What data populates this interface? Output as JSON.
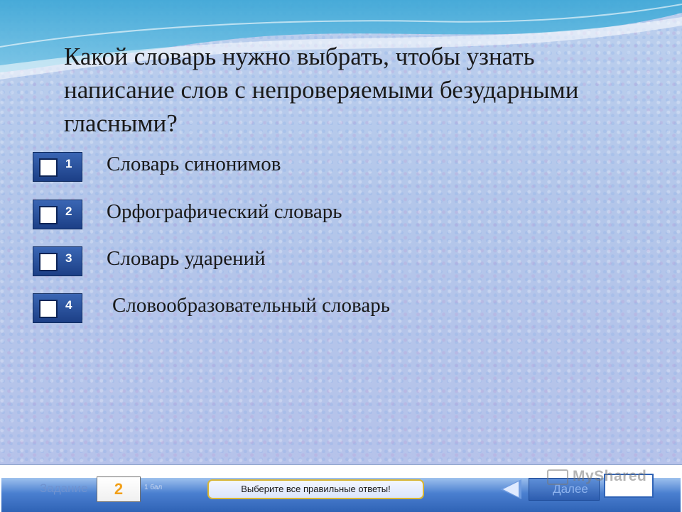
{
  "question": {
    "line1": "Какой словарь нужно выбрать, чтобы узнать",
    "line2": "написание слов с непроверяемыми безударными",
    "line3": "гласными?"
  },
  "options": [
    {
      "number": "1",
      "label": "Словарь синонимов"
    },
    {
      "number": "2",
      "label": "Орфографический словарь"
    },
    {
      "number": "3",
      "label": "Словарь ударений"
    },
    {
      "number": "4",
      "label": "Словообразовательный словарь"
    }
  ],
  "footer": {
    "task_label": "Задание",
    "task_number": "2",
    "points": "1 бал",
    "hint": "Выберите все правильные ответы!",
    "next_label": "Далее"
  },
  "watermark": "MyShared",
  "colors": {
    "checkbox_blue": "#2a52a0",
    "task_number_orange": "#f2a019",
    "hint_border": "#d9b634",
    "bottom_strip": "#2f63b6"
  }
}
